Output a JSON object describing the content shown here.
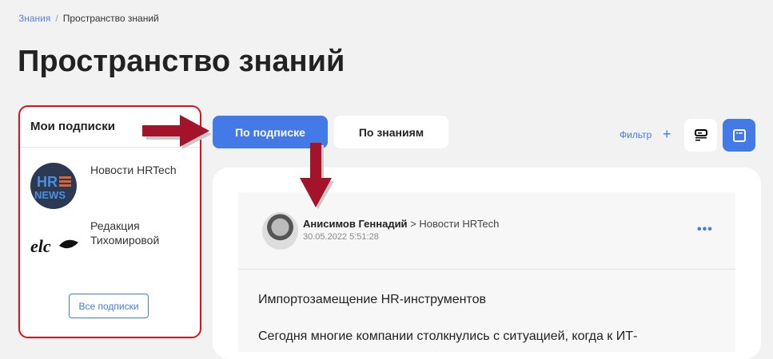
{
  "breadcrumb": {
    "root": "Знания",
    "current": "Пространство знаний"
  },
  "title": "Пространство знаний",
  "sidebar": {
    "title": "Мои подписки",
    "items": [
      {
        "label": "Новости HRTech",
        "logo": "HR NEWS"
      },
      {
        "label": "Редакция Тихомировой",
        "logo": "elc"
      }
    ],
    "all_button": "Все подписки"
  },
  "tabs": [
    {
      "label": "По подписке",
      "active": true
    },
    {
      "label": "По знаниям",
      "active": false
    }
  ],
  "toolbar": {
    "filter": "Фильтр",
    "plus": "+"
  },
  "post": {
    "author": "Анисимов Геннадий",
    "separator": ">",
    "channel": "Новости HRTech",
    "date": "30.05.2022 5:51:28",
    "menu": "•••",
    "title": "Импортозамещение HR-инструментов",
    "text": "Сегодня многие компании столкнулись с ситуацией, когда к ИТ-"
  },
  "colors": {
    "accent": "#4479e8",
    "highlight": "#e0101a",
    "arrow": "#a3132a"
  }
}
